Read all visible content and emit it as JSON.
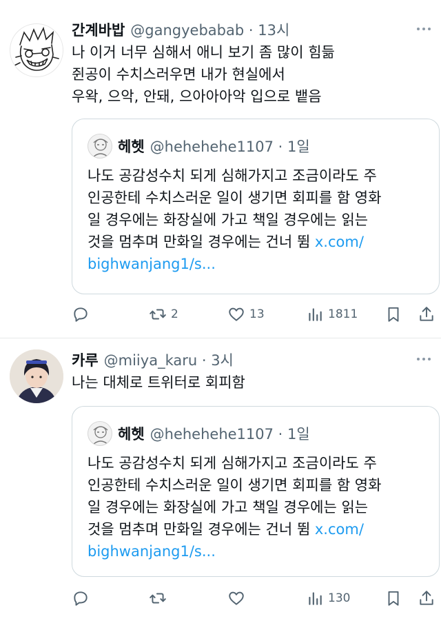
{
  "tweets": [
    {
      "name": "간계바밥",
      "meta": "@gangyebabab · 13시",
      "lines": [
        "나 이거 너무 심해서 애니 보기 좀 많이 힘듦",
        "쥔공이 수치스러우면 내가 현실에서",
        "우왁, 으악, 안돼, 으아아아악 입으로 뱉음"
      ],
      "quote": {
        "name": "헤헷",
        "meta": "@hehehehe1107 · 1일",
        "lines": [
          "나도 공감성수치 되게 심해가지고 조금이라도 주",
          "인공한테 수치스러운 일이 생기면 회피를 함 영화",
          "일 경우에는 화장실에 가고 책일 경우에는 읽는",
          "것을 멈추며 만화일 경우에는 건너 뜀 "
        ],
        "link_1": "x.com/",
        "link_2": "bighwanjang1/s..."
      },
      "retweets": "2",
      "likes": "13",
      "views": "1811"
    },
    {
      "name": "카루",
      "meta": "@miiya_karu · 3시",
      "lines": [
        "나는 대체로 트위터로 회피함"
      ],
      "quote": {
        "name": "헤헷",
        "meta": "@hehehehe1107 · 1일",
        "lines": [
          "나도 공감성수치 되게 심해가지고 조금이라도 주",
          "인공한테 수치스러운 일이 생기면 회피를 함 영화",
          "일 경우에는 화장실에 가고 책일 경우에는 읽는",
          "것을 멈추며 만화일 경우에는 건너 뜀 "
        ],
        "link_1": "x.com/",
        "link_2": "bighwanjang1/s..."
      },
      "retweets": "",
      "likes": "",
      "views": "130"
    }
  ],
  "icons": [
    "more-icon",
    "reply-icon",
    "retweet-icon",
    "like-icon",
    "views-icon",
    "bookmark-icon",
    "share-icon"
  ],
  "colors": {
    "text": "#0f1419",
    "secondary": "#536471",
    "link": "#1d9bf0",
    "border": "#cfd9de"
  }
}
